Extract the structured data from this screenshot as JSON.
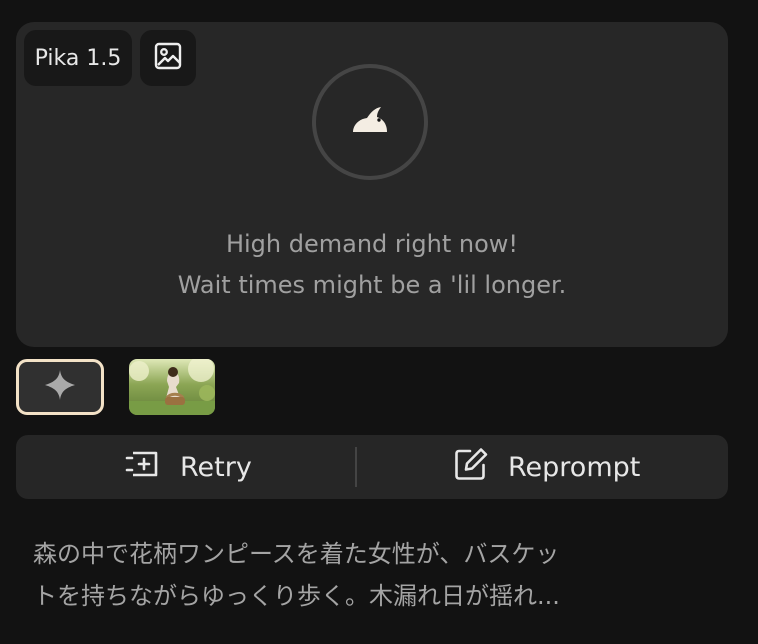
{
  "card": {
    "model_label": "Pika 1.5",
    "status_title": "High demand right now!",
    "status_subtitle": "Wait times might be a 'lil longer."
  },
  "actions": {
    "retry_label": "Retry",
    "reprompt_label": "Reprompt"
  },
  "prompt": {
    "text": "森の中で花柄ワンピースを着た女性が、バスケッ\nトを持ちながらゆっくり歩く。木漏れ日が揺れ..."
  },
  "colors": {
    "background": "#121212",
    "card": "#272727",
    "accent_border": "#f3e2c7",
    "text_primary": "#e7e7e7",
    "text_muted": "#a0a0a0"
  },
  "icons": {
    "image": "image-icon",
    "bunny": "bunny-icon",
    "sparkle": "sparkle-icon",
    "retry": "retry-icon",
    "reprompt": "edit-icon"
  }
}
